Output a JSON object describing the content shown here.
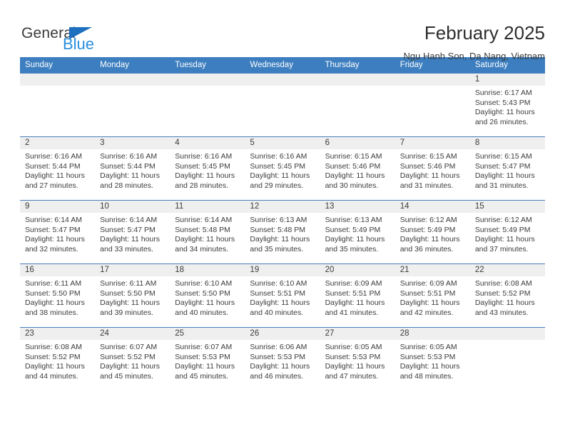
{
  "logo": {
    "word_dark": "General",
    "word_blue": "Blue",
    "triangle_color": "#1e6fbd",
    "blue_color": "#2b8fdd"
  },
  "header": {
    "title": "February 2025",
    "subtitle": "Ngu Hanh Son, Da Nang, Vietnam",
    "header_bg": "#3c7ebf"
  },
  "weekday_headers": [
    "Sunday",
    "Monday",
    "Tuesday",
    "Wednesday",
    "Thursday",
    "Friday",
    "Saturday"
  ],
  "weeks": [
    [
      {
        "day": "",
        "empty": true
      },
      {
        "day": "",
        "empty": true
      },
      {
        "day": "",
        "empty": true
      },
      {
        "day": "",
        "empty": true
      },
      {
        "day": "",
        "empty": true
      },
      {
        "day": "",
        "empty": true
      },
      {
        "day": "1",
        "sunrise": "Sunrise: 6:17 AM",
        "sunset": "Sunset: 5:43 PM",
        "daylight1": "Daylight: 11 hours",
        "daylight2": "and 26 minutes."
      }
    ],
    [
      {
        "day": "2",
        "sunrise": "Sunrise: 6:16 AM",
        "sunset": "Sunset: 5:44 PM",
        "daylight1": "Daylight: 11 hours",
        "daylight2": "and 27 minutes."
      },
      {
        "day": "3",
        "sunrise": "Sunrise: 6:16 AM",
        "sunset": "Sunset: 5:44 PM",
        "daylight1": "Daylight: 11 hours",
        "daylight2": "and 28 minutes."
      },
      {
        "day": "4",
        "sunrise": "Sunrise: 6:16 AM",
        "sunset": "Sunset: 5:45 PM",
        "daylight1": "Daylight: 11 hours",
        "daylight2": "and 28 minutes."
      },
      {
        "day": "5",
        "sunrise": "Sunrise: 6:16 AM",
        "sunset": "Sunset: 5:45 PM",
        "daylight1": "Daylight: 11 hours",
        "daylight2": "and 29 minutes."
      },
      {
        "day": "6",
        "sunrise": "Sunrise: 6:15 AM",
        "sunset": "Sunset: 5:46 PM",
        "daylight1": "Daylight: 11 hours",
        "daylight2": "and 30 minutes."
      },
      {
        "day": "7",
        "sunrise": "Sunrise: 6:15 AM",
        "sunset": "Sunset: 5:46 PM",
        "daylight1": "Daylight: 11 hours",
        "daylight2": "and 31 minutes."
      },
      {
        "day": "8",
        "sunrise": "Sunrise: 6:15 AM",
        "sunset": "Sunset: 5:47 PM",
        "daylight1": "Daylight: 11 hours",
        "daylight2": "and 31 minutes."
      }
    ],
    [
      {
        "day": "9",
        "sunrise": "Sunrise: 6:14 AM",
        "sunset": "Sunset: 5:47 PM",
        "daylight1": "Daylight: 11 hours",
        "daylight2": "and 32 minutes."
      },
      {
        "day": "10",
        "sunrise": "Sunrise: 6:14 AM",
        "sunset": "Sunset: 5:47 PM",
        "daylight1": "Daylight: 11 hours",
        "daylight2": "and 33 minutes."
      },
      {
        "day": "11",
        "sunrise": "Sunrise: 6:14 AM",
        "sunset": "Sunset: 5:48 PM",
        "daylight1": "Daylight: 11 hours",
        "daylight2": "and 34 minutes."
      },
      {
        "day": "12",
        "sunrise": "Sunrise: 6:13 AM",
        "sunset": "Sunset: 5:48 PM",
        "daylight1": "Daylight: 11 hours",
        "daylight2": "and 35 minutes."
      },
      {
        "day": "13",
        "sunrise": "Sunrise: 6:13 AM",
        "sunset": "Sunset: 5:49 PM",
        "daylight1": "Daylight: 11 hours",
        "daylight2": "and 35 minutes."
      },
      {
        "day": "14",
        "sunrise": "Sunrise: 6:12 AM",
        "sunset": "Sunset: 5:49 PM",
        "daylight1": "Daylight: 11 hours",
        "daylight2": "and 36 minutes."
      },
      {
        "day": "15",
        "sunrise": "Sunrise: 6:12 AM",
        "sunset": "Sunset: 5:49 PM",
        "daylight1": "Daylight: 11 hours",
        "daylight2": "and 37 minutes."
      }
    ],
    [
      {
        "day": "16",
        "sunrise": "Sunrise: 6:11 AM",
        "sunset": "Sunset: 5:50 PM",
        "daylight1": "Daylight: 11 hours",
        "daylight2": "and 38 minutes."
      },
      {
        "day": "17",
        "sunrise": "Sunrise: 6:11 AM",
        "sunset": "Sunset: 5:50 PM",
        "daylight1": "Daylight: 11 hours",
        "daylight2": "and 39 minutes."
      },
      {
        "day": "18",
        "sunrise": "Sunrise: 6:10 AM",
        "sunset": "Sunset: 5:50 PM",
        "daylight1": "Daylight: 11 hours",
        "daylight2": "and 40 minutes."
      },
      {
        "day": "19",
        "sunrise": "Sunrise: 6:10 AM",
        "sunset": "Sunset: 5:51 PM",
        "daylight1": "Daylight: 11 hours",
        "daylight2": "and 40 minutes."
      },
      {
        "day": "20",
        "sunrise": "Sunrise: 6:09 AM",
        "sunset": "Sunset: 5:51 PM",
        "daylight1": "Daylight: 11 hours",
        "daylight2": "and 41 minutes."
      },
      {
        "day": "21",
        "sunrise": "Sunrise: 6:09 AM",
        "sunset": "Sunset: 5:51 PM",
        "daylight1": "Daylight: 11 hours",
        "daylight2": "and 42 minutes."
      },
      {
        "day": "22",
        "sunrise": "Sunrise: 6:08 AM",
        "sunset": "Sunset: 5:52 PM",
        "daylight1": "Daylight: 11 hours",
        "daylight2": "and 43 minutes."
      }
    ],
    [
      {
        "day": "23",
        "sunrise": "Sunrise: 6:08 AM",
        "sunset": "Sunset: 5:52 PM",
        "daylight1": "Daylight: 11 hours",
        "daylight2": "and 44 minutes."
      },
      {
        "day": "24",
        "sunrise": "Sunrise: 6:07 AM",
        "sunset": "Sunset: 5:52 PM",
        "daylight1": "Daylight: 11 hours",
        "daylight2": "and 45 minutes."
      },
      {
        "day": "25",
        "sunrise": "Sunrise: 6:07 AM",
        "sunset": "Sunset: 5:53 PM",
        "daylight1": "Daylight: 11 hours",
        "daylight2": "and 45 minutes."
      },
      {
        "day": "26",
        "sunrise": "Sunrise: 6:06 AM",
        "sunset": "Sunset: 5:53 PM",
        "daylight1": "Daylight: 11 hours",
        "daylight2": "and 46 minutes."
      },
      {
        "day": "27",
        "sunrise": "Sunrise: 6:05 AM",
        "sunset": "Sunset: 5:53 PM",
        "daylight1": "Daylight: 11 hours",
        "daylight2": "and 47 minutes."
      },
      {
        "day": "28",
        "sunrise": "Sunrise: 6:05 AM",
        "sunset": "Sunset: 5:53 PM",
        "daylight1": "Daylight: 11 hours",
        "daylight2": "and 48 minutes."
      },
      {
        "day": "",
        "empty": true
      }
    ]
  ]
}
